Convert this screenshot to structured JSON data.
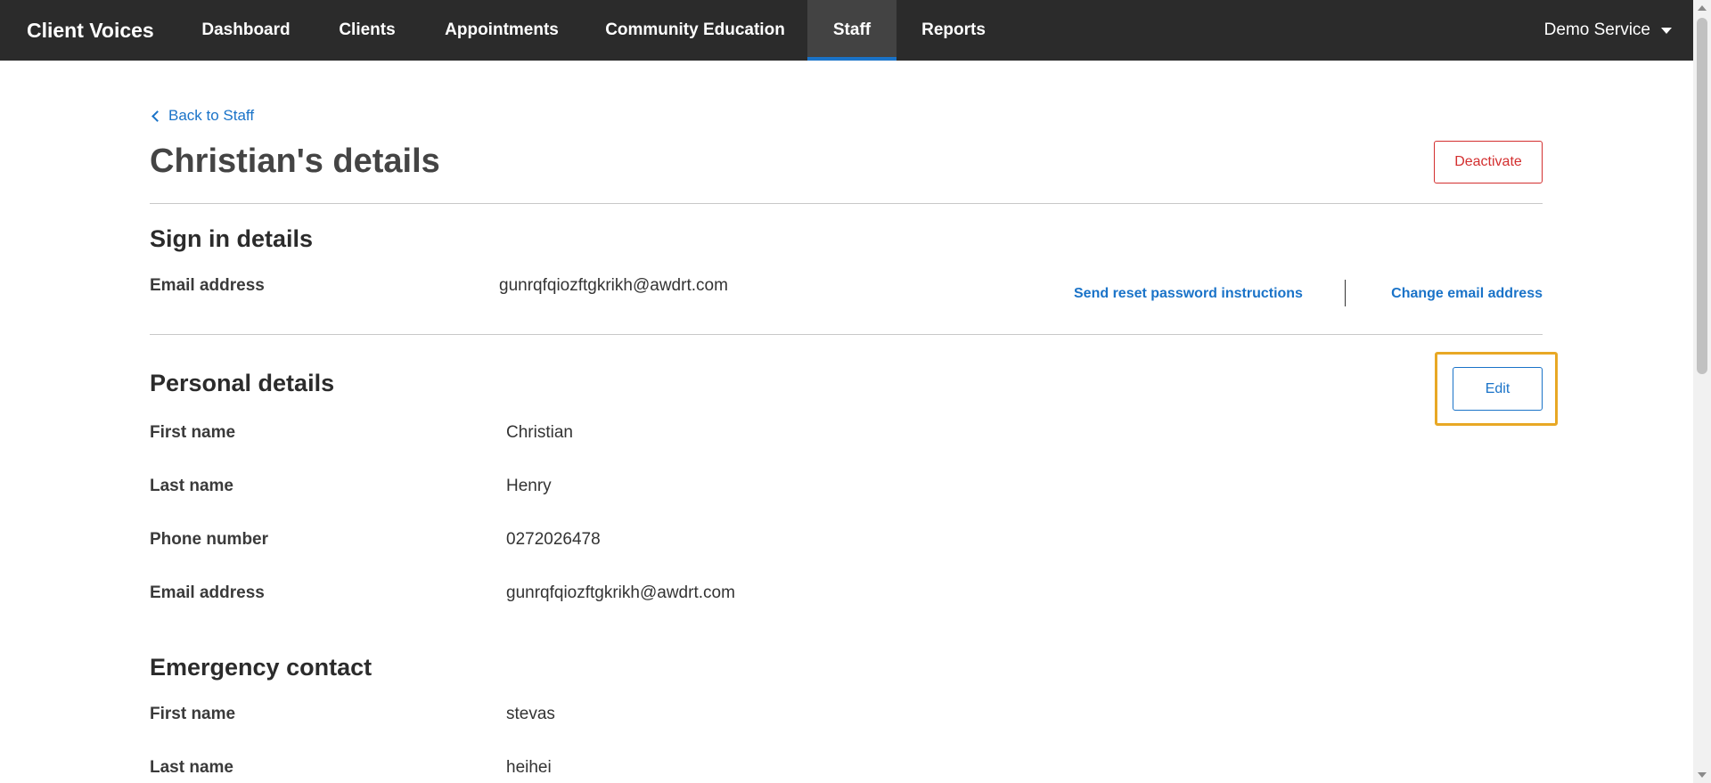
{
  "nav": {
    "brand": "Client Voices",
    "items": [
      {
        "label": "Dashboard"
      },
      {
        "label": "Clients"
      },
      {
        "label": "Appointments"
      },
      {
        "label": "Community Education"
      },
      {
        "label": "Staff",
        "active": true
      },
      {
        "label": "Reports"
      }
    ],
    "service": "Demo Service"
  },
  "page": {
    "back_label": "Back to Staff",
    "title": "Christian's details",
    "deactivate_label": "Deactivate"
  },
  "sign_in": {
    "title": "Sign in details",
    "email_label": "Email address",
    "email_value": "gunrqfqiozftgkrikh@awdrt.com",
    "reset_link": "Send reset password instructions",
    "change_email_link": "Change email address"
  },
  "personal": {
    "title": "Personal details",
    "edit_label": "Edit",
    "fields": [
      {
        "label": "First name",
        "value": "Christian"
      },
      {
        "label": "Last name",
        "value": "Henry"
      },
      {
        "label": "Phone number",
        "value": "0272026478"
      },
      {
        "label": "Email address",
        "value": "gunrqfqiozftgkrikh@awdrt.com"
      }
    ]
  },
  "emergency": {
    "title": "Emergency contact",
    "fields": [
      {
        "label": "First name",
        "value": "stevas"
      },
      {
        "label": "Last name",
        "value": "heihei"
      }
    ]
  },
  "colors": {
    "nav_bg": "#2b2b2b",
    "accent": "#1a73c8",
    "danger": "#d32f2f",
    "highlight": "#e8a825"
  }
}
